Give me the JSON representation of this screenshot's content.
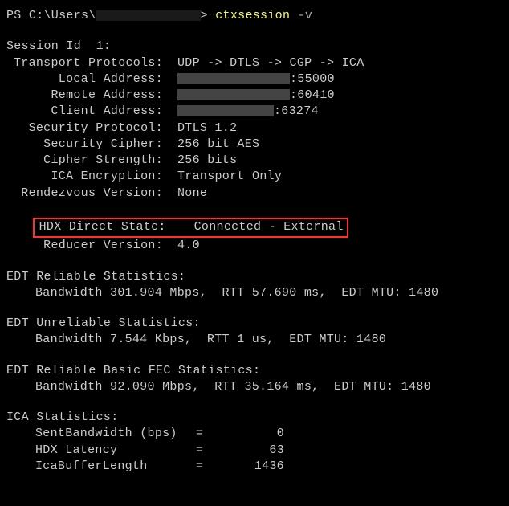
{
  "prompt": {
    "prefix": "PS C:\\Users\\",
    "carrot": "> ",
    "command": "ctxsession",
    "flag": " -v"
  },
  "session": {
    "id_label": "Session Id  1:",
    "rows": [
      {
        "label": "Transport Protocols:",
        "value": "UDP -> DTLS -> CGP -> ICA"
      },
      {
        "label": "Local Address:",
        "value": ":55000",
        "redacted": true
      },
      {
        "label": "Remote Address:",
        "value": ":60410",
        "redacted": true
      },
      {
        "label": "Client Address:",
        "value": ":63274",
        "redacted_sm": true
      },
      {
        "label": "Security Protocol:",
        "value": "DTLS 1.2"
      },
      {
        "label": "Security Cipher:",
        "value": "256 bit AES"
      },
      {
        "label": "Cipher Strength:",
        "value": "256 bits"
      },
      {
        "label": "ICA Encryption:",
        "value": "Transport Only"
      },
      {
        "label": "Rendezvous Version:",
        "value": "None"
      }
    ],
    "highlight": {
      "label": "HDX Direct State:",
      "value": "Connected - External"
    },
    "after_highlight": [
      {
        "label": "Reducer Version:",
        "value": "4.0"
      }
    ]
  },
  "edt_reliable": {
    "title": "EDT Reliable Statistics:",
    "line": "Bandwidth 301.904 Mbps,  RTT 57.690 ms,  EDT MTU: 1480"
  },
  "edt_unreliable": {
    "title": "EDT Unreliable Statistics:",
    "line": "Bandwidth 7.544 Kbps,  RTT 1 us,  EDT MTU: 1480"
  },
  "edt_fec": {
    "title": "EDT Reliable Basic FEC Statistics:",
    "line": "Bandwidth 92.090 Mbps,  RTT 35.164 ms,  EDT MTU: 1480"
  },
  "ica": {
    "title": "ICA Statistics:",
    "rows": [
      {
        "label": "SentBandwidth (bps)",
        "value": "0"
      },
      {
        "label": "HDX Latency",
        "value": "63"
      },
      {
        "label": "IcaBufferLength",
        "value": "1436"
      }
    ]
  }
}
